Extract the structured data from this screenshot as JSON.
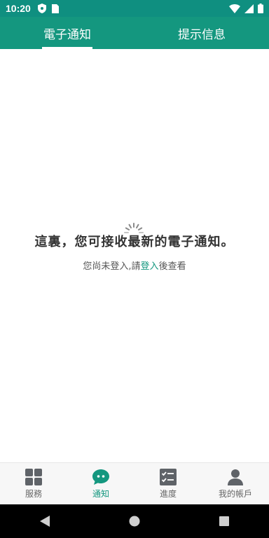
{
  "status_bar": {
    "time": "10:20",
    "left_icons": [
      "shield-icon",
      "sim-card-icon"
    ],
    "right_icons": [
      "wifi-icon",
      "signal-icon",
      "battery-icon"
    ]
  },
  "top_tabs": [
    {
      "label": "電子通知",
      "active": true
    },
    {
      "label": "提示信息",
      "active": false
    }
  ],
  "empty_state": {
    "title": "這裏，您可接收最新的電子通知。",
    "subtitle_prefix": "您尚未登入,請",
    "login_link": "登入",
    "subtitle_suffix": "後查看"
  },
  "bottom_nav": [
    {
      "label": "服務",
      "icon": "grid-icon",
      "active": false
    },
    {
      "label": "通知",
      "icon": "chat-bubble-icon",
      "active": true
    },
    {
      "label": "進度",
      "icon": "checklist-icon",
      "active": false
    },
    {
      "label": "我的帳戶",
      "icon": "user-icon",
      "active": false
    }
  ],
  "colors": {
    "primary": "#14977f",
    "status_bar": "#0f8f80",
    "inactive_icon": "#5f6368"
  }
}
